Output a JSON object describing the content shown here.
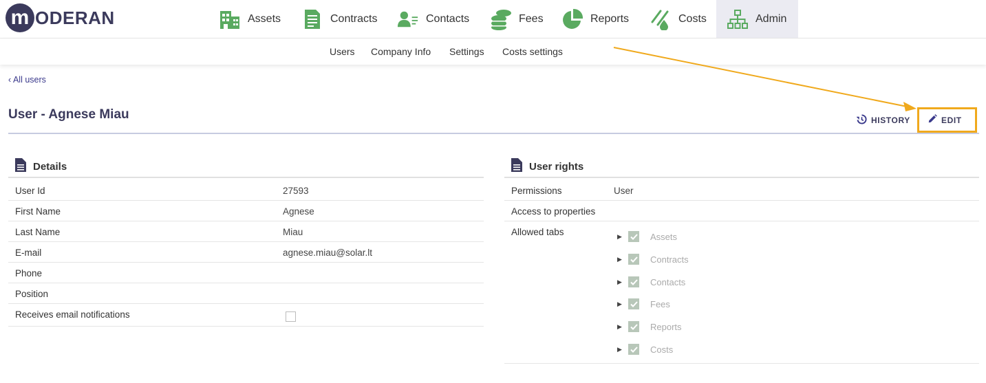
{
  "brand": {
    "logo_letter": "m",
    "logo_text": "ODERAN"
  },
  "nav": {
    "items": [
      {
        "label": "Assets",
        "icon": "building-icon"
      },
      {
        "label": "Contracts",
        "icon": "document-icon"
      },
      {
        "label": "Contacts",
        "icon": "contact-card-icon"
      },
      {
        "label": "Fees",
        "icon": "coins-icon"
      },
      {
        "label": "Reports",
        "icon": "pie-chart-icon"
      },
      {
        "label": "Costs",
        "icon": "costs-icon"
      },
      {
        "label": "Admin",
        "icon": "org-chart-icon"
      }
    ],
    "active": "Admin"
  },
  "subnav": {
    "items": [
      "Users",
      "Company Info",
      "Settings",
      "Costs settings"
    ]
  },
  "breadcrumb": {
    "back_label": "All users"
  },
  "page": {
    "title": "User - Agnese Miau"
  },
  "actions": {
    "history_label": "HISTORY",
    "edit_label": "EDIT"
  },
  "details": {
    "title": "Details",
    "rows": [
      {
        "label": "User Id",
        "value": "27593"
      },
      {
        "label": "First Name",
        "value": "Agnese"
      },
      {
        "label": "Last Name",
        "value": "Miau"
      },
      {
        "label": "E-mail",
        "value": "agnese.miau@solar.lt"
      },
      {
        "label": "Phone",
        "value": ""
      },
      {
        "label": "Position",
        "value": ""
      },
      {
        "label": "Receives email notifications",
        "value": "",
        "checked": false
      }
    ]
  },
  "rights": {
    "title": "User rights",
    "permissions_label": "Permissions",
    "permissions_value": "User",
    "access_label": "Access to properties",
    "tabs_label": "Allowed tabs",
    "tabs": [
      "Assets",
      "Contracts",
      "Contacts",
      "Fees",
      "Reports",
      "Costs"
    ]
  },
  "colors": {
    "brand": "#3b3a5c",
    "icon_green": "#5aaa60",
    "highlight": "#f0a91c",
    "link": "#3b3a8c"
  }
}
